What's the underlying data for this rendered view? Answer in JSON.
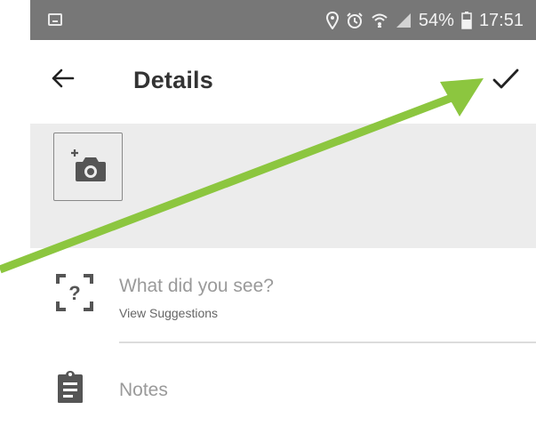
{
  "status_bar": {
    "battery": "54%",
    "time": "17:51",
    "icons": [
      "screenshot-icon",
      "location-icon",
      "alarm-icon",
      "wifi-icon",
      "signal-icon",
      "battery-icon"
    ]
  },
  "app_bar": {
    "title": "Details",
    "back_icon": "back-arrow-icon",
    "confirm_icon": "checkmark-icon"
  },
  "photo": {
    "add_photo_icon": "add-photo-icon"
  },
  "species": {
    "placeholder": "What did you see?",
    "suggestions_link": "View Suggestions",
    "icon": "unknown-species-icon"
  },
  "notes": {
    "placeholder": "Notes",
    "icon": "clipboard-icon"
  },
  "annotation": {
    "arrow_color": "#8cc63f",
    "points_to": "checkmark-icon"
  },
  "colors": {
    "status_bar": "#777777",
    "photo_area": "#ececec",
    "placeholder_text": "#9a9a9a",
    "title_text": "#333333"
  }
}
